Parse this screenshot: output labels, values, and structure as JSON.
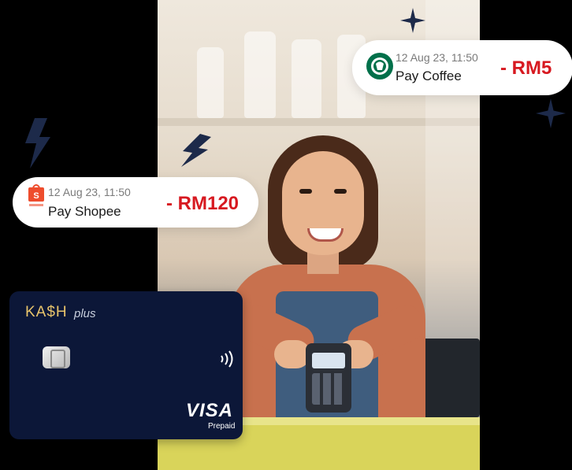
{
  "transactions": [
    {
      "merchant_logo": "starbucks-logo",
      "date": "12 Aug 23, 11:50",
      "merchant": "Pay Coffee",
      "amount": "- RM5"
    },
    {
      "merchant_logo": "shopee-logo",
      "date": "12 Aug 23, 11:50",
      "merchant": "Pay Shopee",
      "amount": "- RM120"
    }
  ],
  "card": {
    "brand": "KA$H",
    "brand_suffix": "plus",
    "network": "VISA",
    "type": "Prepaid",
    "color": "#0c1738",
    "brand_color": "#e8c46b"
  },
  "colors": {
    "amount": "#d71920",
    "background": "#000000",
    "sparkle": "#1d2a4a"
  },
  "icons": [
    "lightning-bolt-icon",
    "sparkle-star-icon",
    "contactless-icon",
    "chip-icon"
  ]
}
